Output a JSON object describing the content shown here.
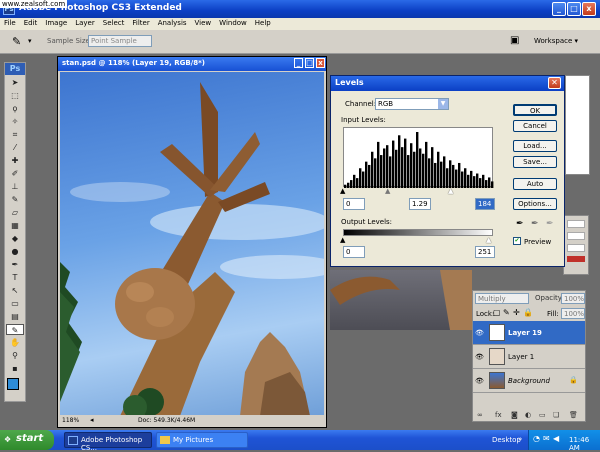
{
  "watermark": "www.zealsoft.com",
  "window": {
    "title": "Adobe Photoshop CS3 Extended",
    "min": "_",
    "max": "□",
    "close": "x"
  },
  "menu": [
    "File",
    "Edit",
    "Image",
    "Layer",
    "Select",
    "Filter",
    "Analysis",
    "View",
    "Window",
    "Help"
  ],
  "options": {
    "sample_size_label": "Sample Size:",
    "sample_size_value": "Point Sample",
    "workspace": "Workspace ▾"
  },
  "toolbox": {
    "logo": "Ps"
  },
  "document": {
    "title": "stan.psd @ 118% (Layer 19, RGB/8*)",
    "zoom": "118%",
    "doc_info": "Doc: 549.3K/4.46M"
  },
  "levels": {
    "title": "Levels",
    "channel_label": "Channel:",
    "channel_value": "RGB",
    "input_label": "Input Levels:",
    "input_black": "0",
    "input_gamma": "1.29",
    "input_white": "184",
    "output_label": "Output Levels:",
    "output_black": "0",
    "output_white": "251",
    "ok": "OK",
    "cancel": "Cancel",
    "load": "Load...",
    "save": "Save...",
    "auto": "Auto",
    "options": "Options...",
    "preview": "Preview",
    "histogram": [
      5,
      8,
      12,
      20,
      15,
      30,
      25,
      40,
      35,
      55,
      45,
      70,
      50,
      60,
      65,
      48,
      72,
      58,
      80,
      62,
      75,
      50,
      68,
      55,
      85,
      60,
      52,
      70,
      45,
      62,
      38,
      55,
      40,
      48,
      30,
      42,
      35,
      28,
      38,
      25,
      30,
      20,
      26,
      18,
      22,
      15,
      20,
      12,
      16,
      10
    ]
  },
  "layers": {
    "blend": "Multiply",
    "opacity_label": "Opacity:",
    "opacity": "100%",
    "lock_label": "Lock:",
    "fill_label": "Fill:",
    "fill": "100%",
    "rows": [
      {
        "name": "Layer 19"
      },
      {
        "name": "Layer 1"
      },
      {
        "name": "Background"
      }
    ]
  },
  "taskbar": {
    "start": "start",
    "tasks": [
      "Adobe Photoshop CS...",
      "My Pictures"
    ],
    "desktop": "Desktop",
    "time": "11:46 AM"
  }
}
